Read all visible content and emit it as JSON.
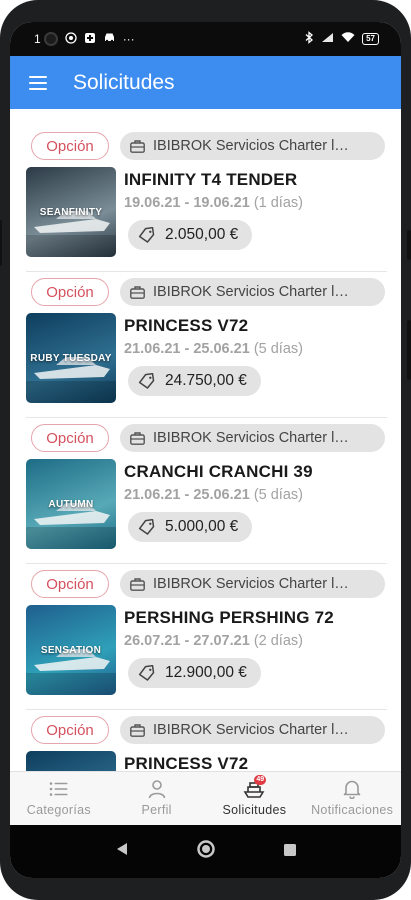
{
  "status_bar": {
    "left_text": "1",
    "dots": "···",
    "battery": "57"
  },
  "app_bar": {
    "title": "Solicitudes"
  },
  "requests": [
    {
      "status": "Opción",
      "company": "IBIBROK Servicios Charter l…",
      "boat": "INFINITY T4 TENDER",
      "dates": "19.06.21 - 19.06.21",
      "duration": "(1 días)",
      "price": "2.050,00 €",
      "thumb_label": "SEANFINITY",
      "thumb_colors": [
        "#2b3a46",
        "#7b8e98"
      ]
    },
    {
      "status": "Opción",
      "company": "IBIBROK Servicios Charter l…",
      "boat": "PRINCESS V72",
      "dates": "21.06.21 - 25.06.21",
      "duration": "(5 días)",
      "price": "24.750,00 €",
      "thumb_label": "RUBY TUESDAY",
      "thumb_colors": [
        "#0e3e5e",
        "#2f6f90"
      ]
    },
    {
      "status": "Opción",
      "company": "IBIBROK Servicios Charter l…",
      "boat": "CRANCHI CRANCHI 39",
      "dates": "21.06.21 - 25.06.21",
      "duration": "(5 días)",
      "price": "5.000,00 €",
      "thumb_label": "AUTUMN",
      "thumb_colors": [
        "#1d6c86",
        "#58a9b7"
      ]
    },
    {
      "status": "Opción",
      "company": "IBIBROK Servicios Charter l…",
      "boat": "PERSHING PERSHING 72",
      "dates": "26.07.21 - 27.07.21",
      "duration": "(2 días)",
      "price": "12.900,00 €",
      "thumb_label": "SENSATION",
      "thumb_colors": [
        "#1f5f8e",
        "#2fa0b8"
      ]
    },
    {
      "status": "Opción",
      "company": "IBIBROK Servicios Charter l…",
      "boat": "PRINCESS V72",
      "dates": "",
      "duration": "",
      "price": "",
      "thumb_label": "",
      "thumb_colors": [
        "#0e3e5e",
        "#2f6f90"
      ]
    }
  ],
  "bottom_nav": {
    "items": [
      {
        "label": "Categorías",
        "icon": "list-icon",
        "active": false
      },
      {
        "label": "Perfil",
        "icon": "person-icon",
        "active": false
      },
      {
        "label": "Solicitudes",
        "icon": "boat-icon",
        "active": true,
        "badge": "49"
      },
      {
        "label": "Notificaciones",
        "icon": "bell-icon",
        "active": false
      }
    ]
  },
  "colors": {
    "primary": "#3d8cf0",
    "option_chip": "#d4515e",
    "chip_bg": "#e3e3e3",
    "badge": "#e03a45"
  }
}
